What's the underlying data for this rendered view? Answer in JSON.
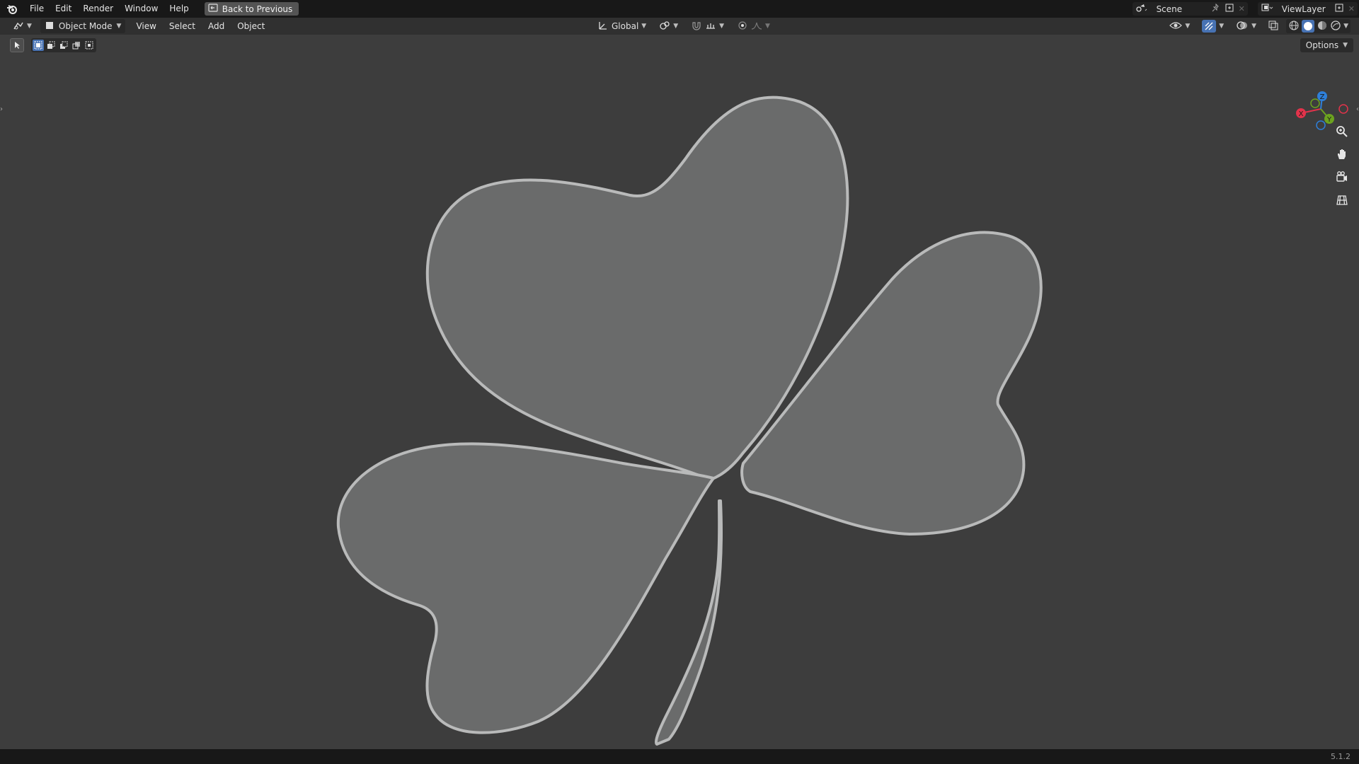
{
  "topbar": {
    "menus": [
      "File",
      "Edit",
      "Render",
      "Window",
      "Help"
    ],
    "back_label": "Back to Previous",
    "scene_name": "Scene",
    "view_layer": "ViewLayer"
  },
  "viewport_header": {
    "mode": "Object Mode",
    "menus": [
      "View",
      "Select",
      "Add",
      "Object"
    ],
    "transform_orientation": "Global"
  },
  "toolrow": {
    "options_label": "Options"
  },
  "gizmo": {
    "x_label": "X",
    "y_label": "Y",
    "z_label": "Z",
    "x_color": "#e2334b",
    "y_color": "#6ca31f",
    "z_color": "#2e7fd9"
  },
  "status": {
    "version": "5.1.2"
  },
  "colors": {
    "viewport_bg": "#3d3d3d",
    "mesh_fill": "#6a6b6b",
    "mesh_edge": "#b9baba",
    "accent": "#4772b3"
  }
}
